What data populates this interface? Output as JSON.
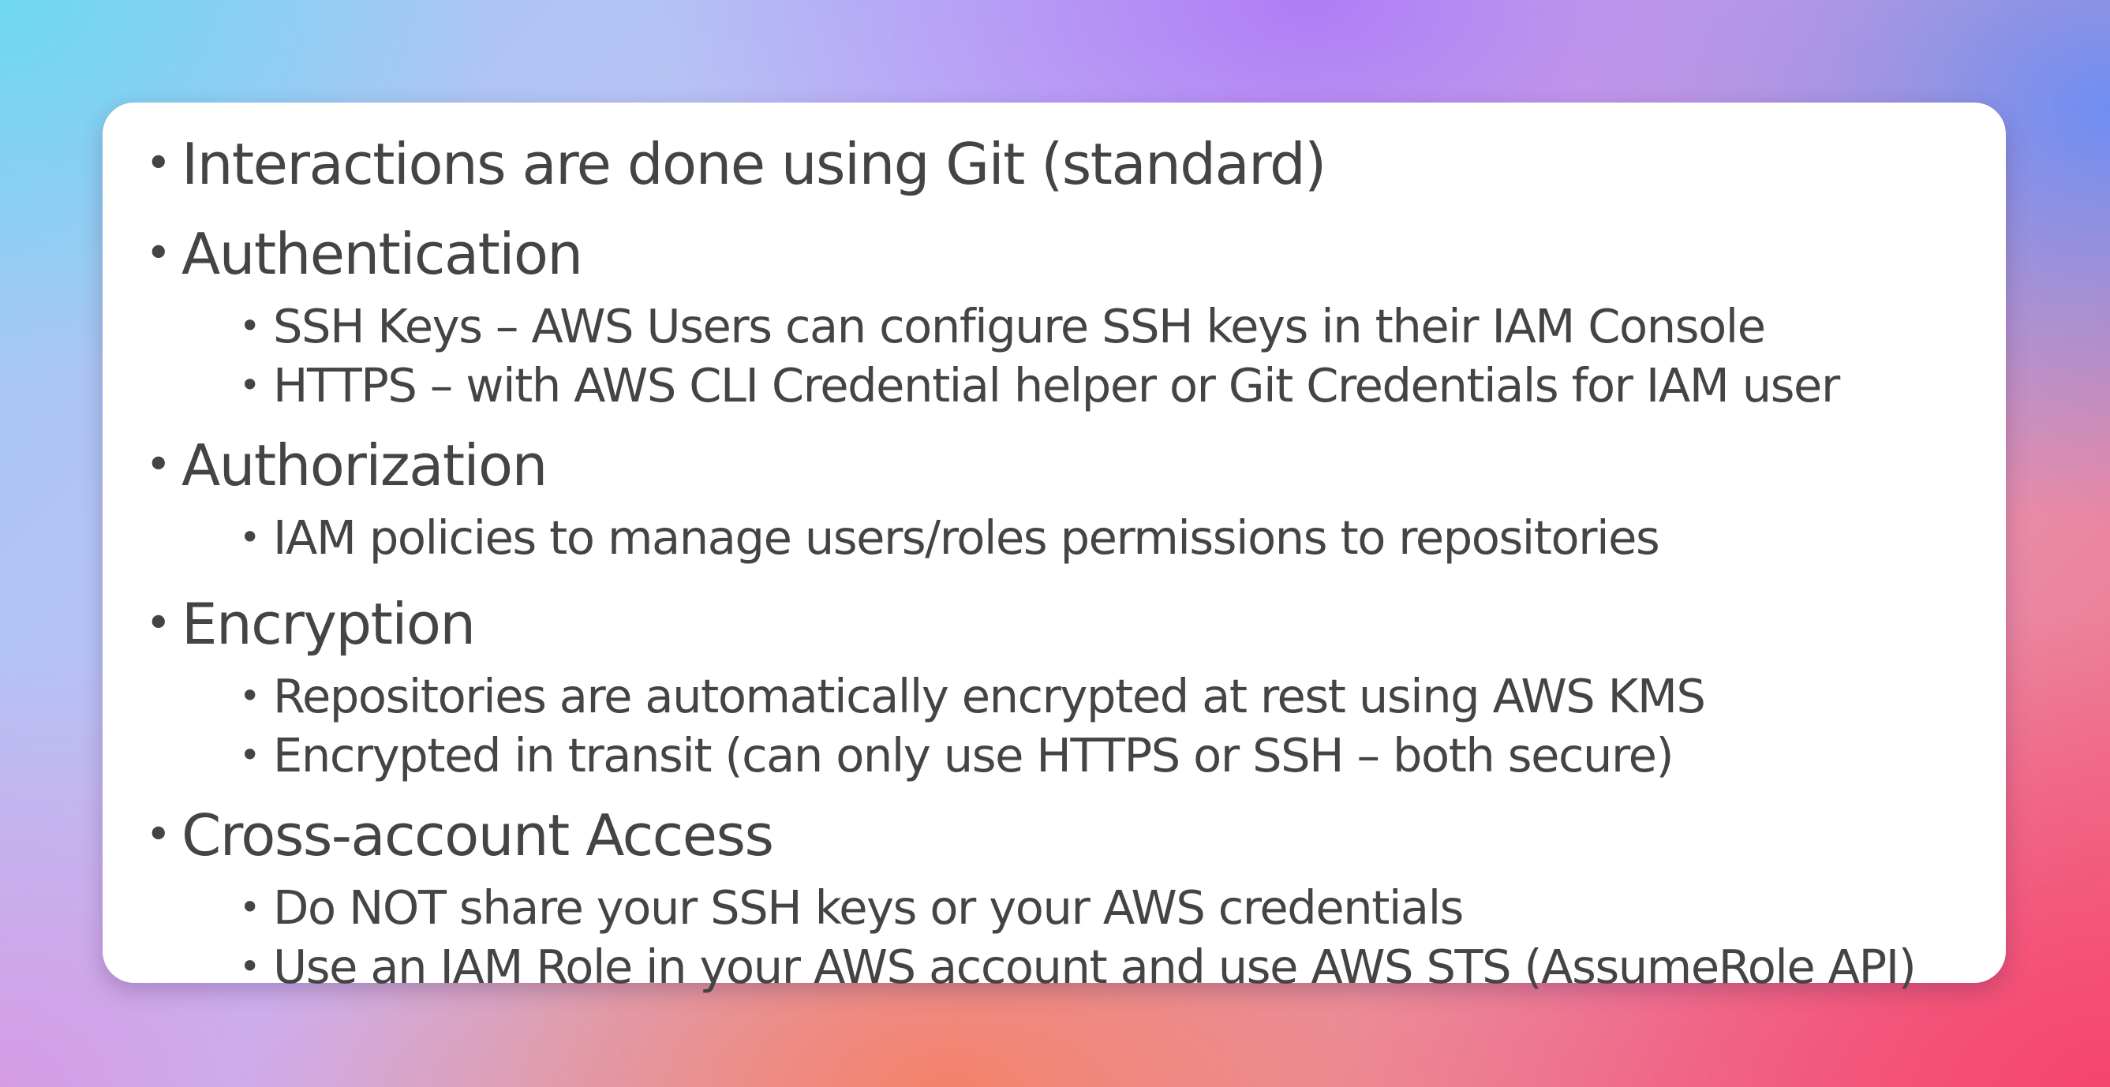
{
  "slide": {
    "sections": [
      {
        "heading": "Interactions are done using Git (standard)",
        "items": []
      },
      {
        "heading": "Authentication",
        "items": [
          "SSH Keys – AWS Users can configure SSH keys in their IAM Console",
          "HTTPS – with AWS CLI Credential helper or Git Credentials for IAM user"
        ]
      },
      {
        "heading": "Authorization",
        "items": [
          "IAM policies to manage users/roles permissions to repositories"
        ]
      },
      {
        "heading": "Encryption",
        "items": [
          "Repositories are automatically encrypted at rest using AWS KMS",
          "Encrypted in transit (can only use HTTPS or SSH – both secure)"
        ]
      },
      {
        "heading": "Cross-account Access",
        "items": [
          "Do NOT share your SSH keys or your AWS credentials",
          "Use an IAM Role in your AWS account and use AWS STS (AssumeRole API)"
        ]
      }
    ],
    "bullet_glyph": "•"
  }
}
